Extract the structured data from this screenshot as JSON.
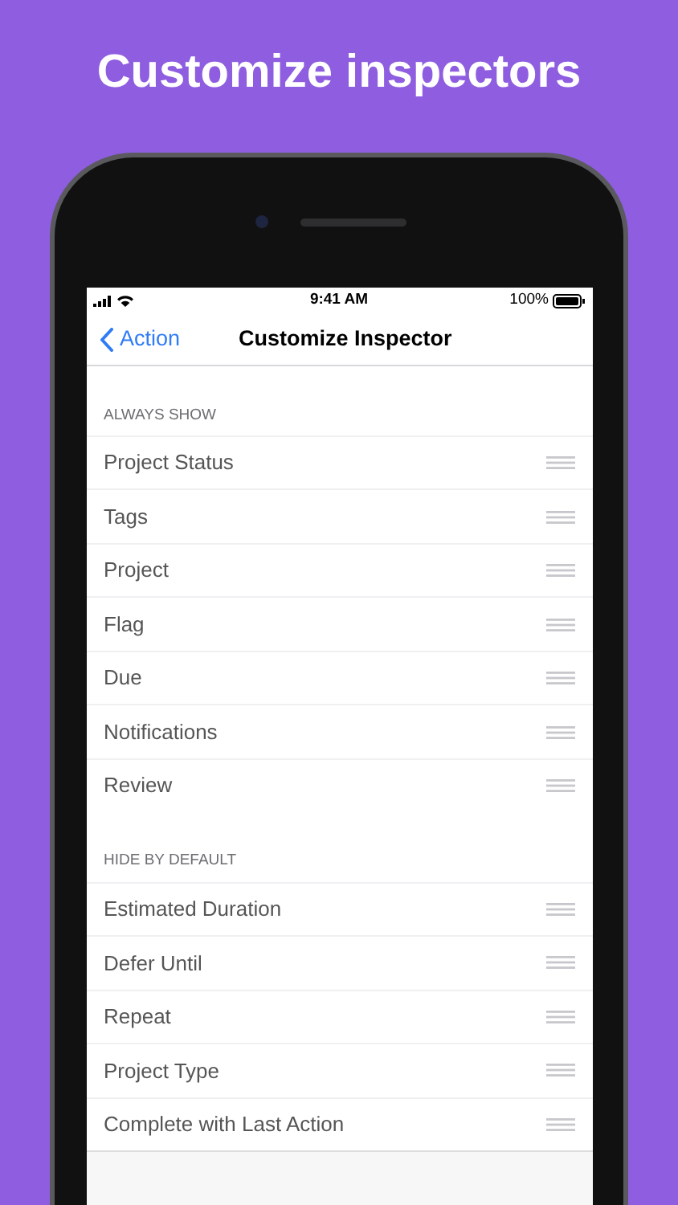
{
  "headline": "Customize inspectors",
  "status_bar": {
    "time": "9:41 AM",
    "battery": "100%"
  },
  "nav": {
    "back": "Action",
    "title": "Customize Inspector"
  },
  "sections": [
    {
      "header": "ALWAYS SHOW",
      "rows": [
        "Project Status",
        "Tags",
        "Project",
        "Flag",
        "Due",
        "Notifications",
        "Review"
      ]
    },
    {
      "header": "HIDE BY DEFAULT",
      "rows": [
        "Estimated Duration",
        "Defer Until",
        "Repeat",
        "Project Type",
        "Complete with Last Action"
      ]
    }
  ]
}
